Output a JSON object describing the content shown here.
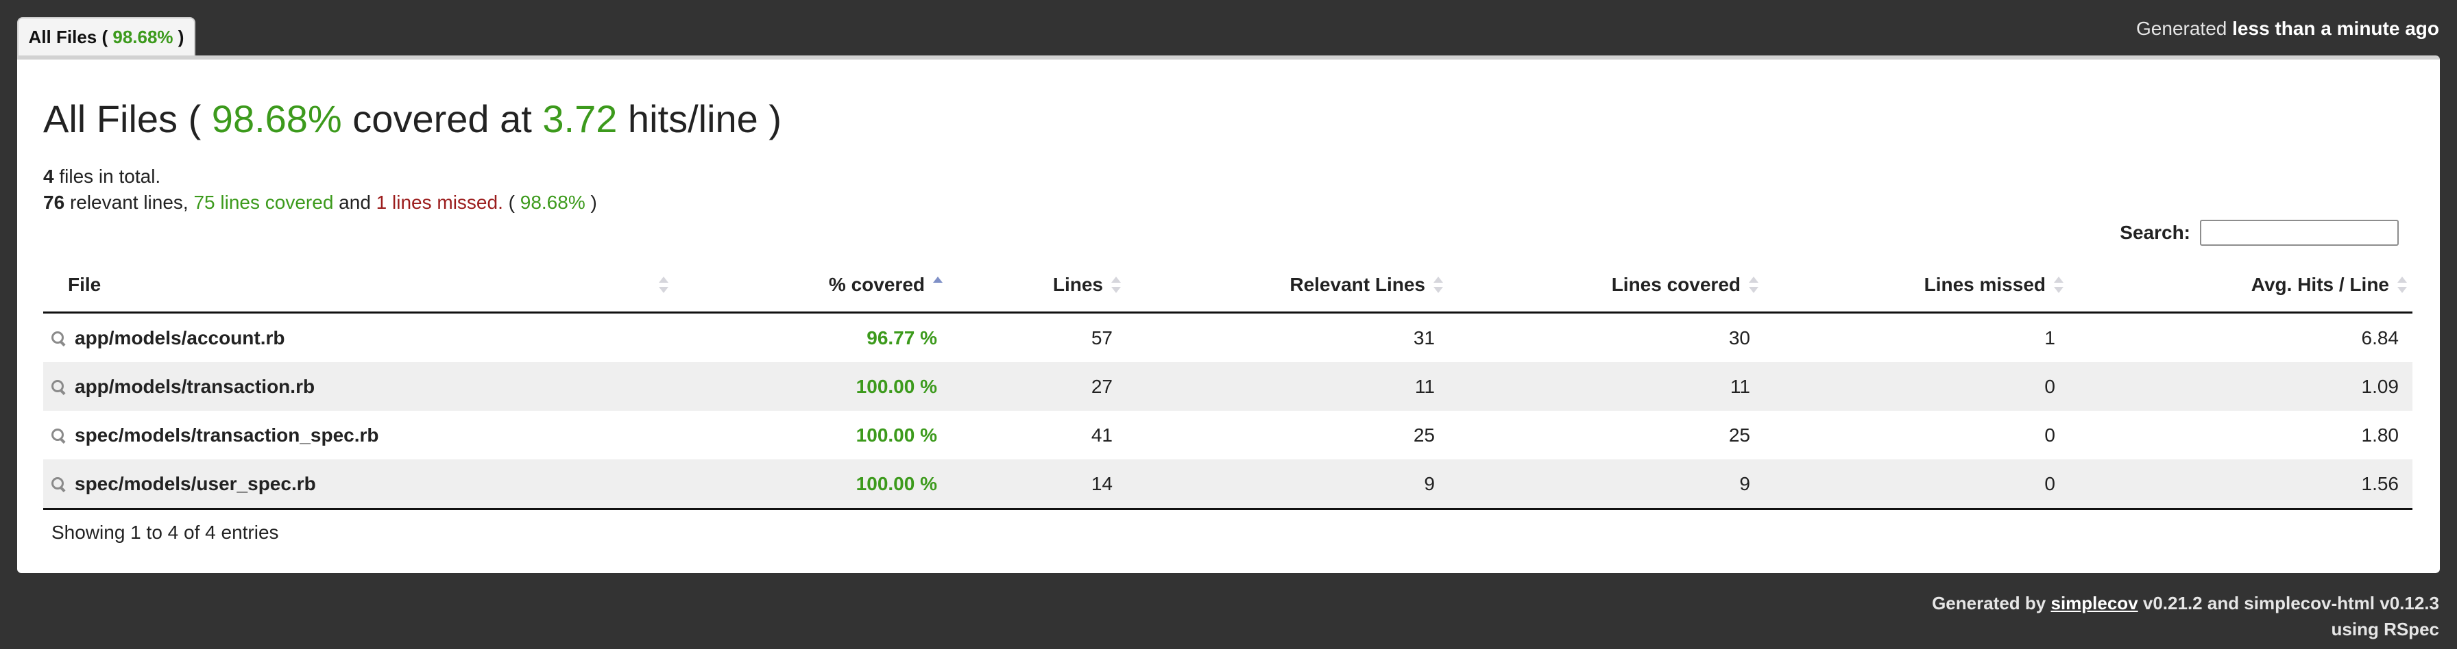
{
  "tab": {
    "label_prefix": "All Files (",
    "percent": "98.68%",
    "label_suffix": ")"
  },
  "generated": {
    "prefix": "Generated",
    "when": "less than a minute ago"
  },
  "summary": {
    "title_prefix": "All Files (",
    "coverage_percent": "98.68%",
    "title_mid": "covered at",
    "hits_per_line": "3.72",
    "title_suffix": "hits/line )",
    "files_count": "4",
    "files_text": "files in total.",
    "relevant_lines": "76",
    "relevant_text": "relevant lines,",
    "lines_covered_text": "75 lines covered",
    "and_text": "and",
    "lines_missed_text": "1 lines missed.",
    "paren_open": "(",
    "percent": "98.68%",
    "paren_close": ")"
  },
  "search": {
    "label": "Search:",
    "value": "",
    "placeholder": ""
  },
  "table": {
    "headers": [
      "File",
      "% covered",
      "Lines",
      "Relevant Lines",
      "Lines covered",
      "Lines missed",
      "Avg. Hits / Line"
    ],
    "rows": [
      {
        "file": "app/models/account.rb",
        "covered": "96.77 %",
        "lines": "57",
        "relevant": "31",
        "lines_covered": "30",
        "missed": "1",
        "avg_hits": "6.84"
      },
      {
        "file": "app/models/transaction.rb",
        "covered": "100.00 %",
        "lines": "27",
        "relevant": "11",
        "lines_covered": "11",
        "missed": "0",
        "avg_hits": "1.09"
      },
      {
        "file": "spec/models/transaction_spec.rb",
        "covered": "100.00 %",
        "lines": "41",
        "relevant": "25",
        "lines_covered": "25",
        "missed": "0",
        "avg_hits": "1.80"
      },
      {
        "file": "spec/models/user_spec.rb",
        "covered": "100.00 %",
        "lines": "14",
        "relevant": "9",
        "lines_covered": "9",
        "missed": "0",
        "avg_hits": "1.56"
      }
    ],
    "info": "Showing 1 to 4 of 4 entries"
  },
  "footer": {
    "prefix": "Generated by",
    "link": "simplecov",
    "versions": "v0.21.2 and simplecov-html v0.12.3",
    "line2": "using RSpec"
  },
  "colors": {
    "covered": "#3c9a1c",
    "missed": "#9b1c1c",
    "background": "#333333"
  },
  "icons": [
    "magnifier-icon",
    "sort-arrows-icon",
    "sort-ascending-icon"
  ]
}
